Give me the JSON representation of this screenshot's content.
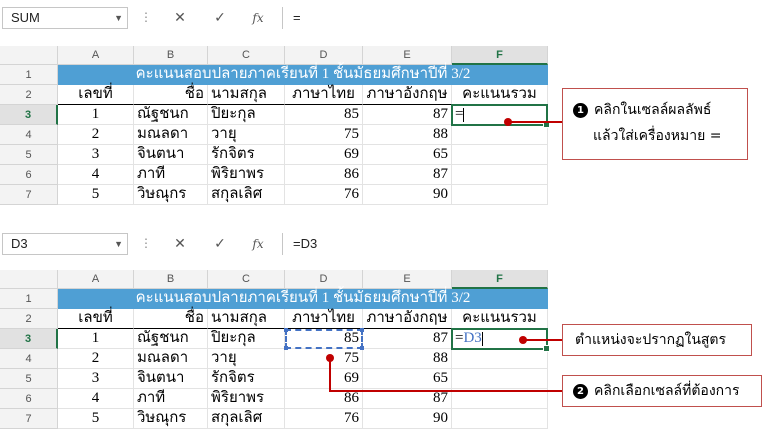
{
  "columns": [
    "A",
    "B",
    "C",
    "D",
    "E",
    "F"
  ],
  "rows": [
    "1",
    "2",
    "3",
    "4",
    "5",
    "6",
    "7"
  ],
  "table": {
    "title": "คะแนนสอบปลายภาคเรียนที่ 1 ชั้นมัธยมศึกษาปีที่ 3/2",
    "headers": [
      "เลขที่",
      "ชื่อ",
      "นามสกุล",
      "ภาษาไทย",
      "ภาษาอังกฤษ",
      "คะแนนรวม"
    ],
    "data": [
      [
        "1",
        "ณัฐชนก",
        "ปิยะกุล",
        "85",
        "87"
      ],
      [
        "2",
        "มณลดา",
        "วายุ",
        "75",
        "88"
      ],
      [
        "3",
        "จินตนา",
        "รักจิตร",
        "69",
        "65"
      ],
      [
        "4",
        "ภาที",
        "พิริยาพร",
        "86",
        "87"
      ],
      [
        "5",
        "วิษณุกร",
        "สกุลเลิศ",
        "76",
        "90"
      ]
    ]
  },
  "formula_buttons": {
    "cancel": "✕",
    "enter": "✓",
    "fx": "fx",
    "dots": "⋮"
  },
  "panel1": {
    "name_box": "SUM",
    "formula": "=",
    "cell_f3": "="
  },
  "panel2": {
    "name_box": "D3",
    "formula": "=D3",
    "cell_f3_eq": "=",
    "cell_f3_ref": "D3"
  },
  "callouts": {
    "step1_number": "1",
    "step1_line1": "คลิกในเซลล์ผลลัพธ์",
    "step1_line2": "แล้วใส่เครื่องหมาย =",
    "formula_note": "ตำแหน่งจะปรากฏในสูตร",
    "step2_number": "2",
    "step2_text": "คลิกเลือกเซลล์ที่ต้องการ"
  },
  "colors": {
    "title_fill": "#4f9fd4",
    "active_border": "#217346",
    "callout_border": "#c0504d",
    "ref_blue": "#4472c4"
  }
}
